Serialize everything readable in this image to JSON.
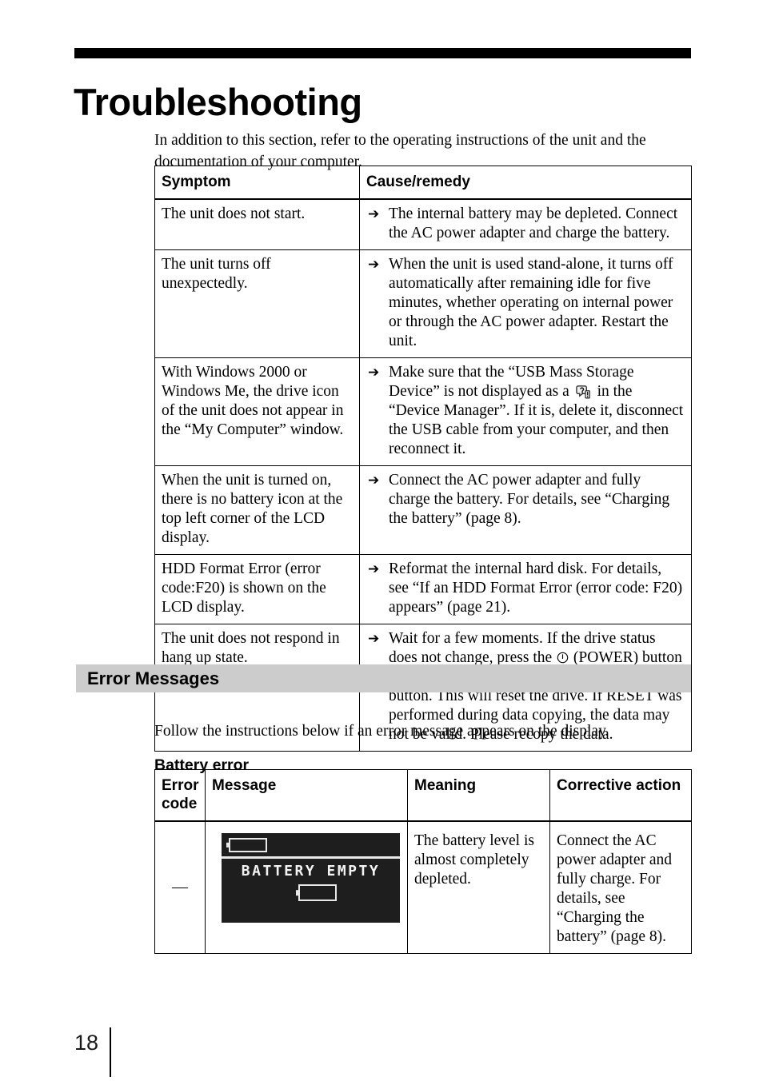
{
  "page": {
    "title": "Troubleshooting",
    "number": "18",
    "intro": "In addition to this section, refer to the operating instructions of the unit and the documentation of your computer."
  },
  "colors": {
    "rule": "#000000",
    "section_bar": "#cccccc",
    "lcd_background": "#1e1e1e",
    "lcd_foreground": "#f2f2f2"
  },
  "symptom_table": {
    "headers": {
      "symptom": "Symptom",
      "cause": "Cause/remedy"
    },
    "arrow_glyph": "➔",
    "rows": [
      {
        "symptom": "The unit does not start.",
        "cause": "The internal battery may be depleted. Connect the AC power adapter and charge the battery."
      },
      {
        "symptom": "The unit turns off unexpectedly.",
        "cause": "When the unit is used stand-alone, it turns off automatically after remaining idle for five minutes, whether operating on internal power or through the AC power adapter. Restart the unit."
      },
      {
        "symptom": "With Windows 2000 or Windows Me, the drive icon of the unit does not appear in the “My Computer” window.",
        "cause_part1": "Make sure that the “USB Mass Storage Device” is not displayed as a",
        "cause_part2": "in the “Device Manager”. If it is, delete it, disconnect the USB cable from your computer, and then reconnect it.",
        "inline_icon": "unknown-device-icon"
      },
      {
        "symptom": "When the unit is turned on, there is no battery icon at the top left corner of the LCD display.",
        "cause": "Connect the AC power adapter and fully charge the battery. For details, see “Charging the battery” (page 8)."
      },
      {
        "symptom": "HDD Format Error (error code:F20) is shown on the LCD display.",
        "cause": "Reformat the internal hard disk. For details, see “If an HDD Format Error (error code: F20) appears” (page 21)."
      },
      {
        "symptom": "The unit does not respond in hang up state.",
        "cause_part1": "Wait for a few moments. If the drive status does not change, press the",
        "cause_part2": "(POWER) button while holding down the COPY and CANCEL button. This will reset the drive. If RESET was performed during data copying, the data may not be valid. Please recopy the data.",
        "inline_icon": "power-symbol-icon"
      }
    ]
  },
  "error_messages": {
    "heading": "Error Messages",
    "intro": "Follow the instructions below if an error message appears on the display.",
    "subsection": "Battery error",
    "table": {
      "headers": {
        "code": "Error code",
        "message": "Message",
        "meaning": "Meaning",
        "action": "Corrective action"
      },
      "rows": [
        {
          "code": "—",
          "lcd_message": "BATTERY EMPTY",
          "meaning": "The battery level is almost completely depleted.",
          "action": "Connect the AC power adapter and fully charge. For details, see “Charging the battery” (page 8)."
        }
      ]
    }
  }
}
